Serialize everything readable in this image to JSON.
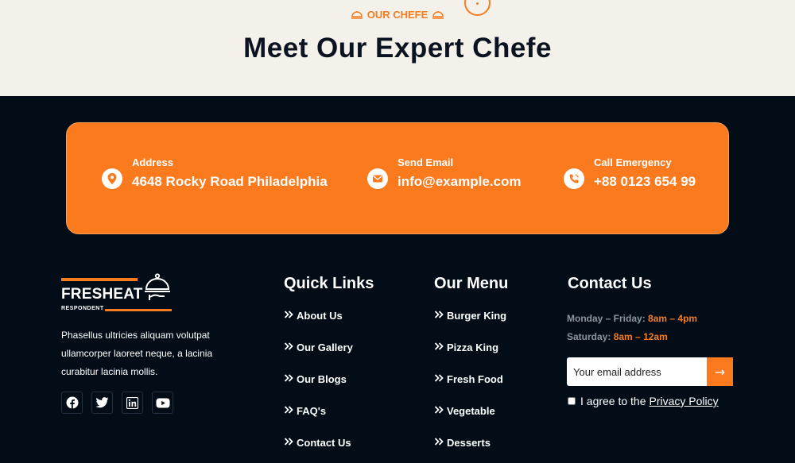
{
  "section": {
    "subtitle": "OUR CHEFE",
    "title": "Meet Our Expert Chefe"
  },
  "contact_bar": {
    "address": {
      "label": "Address",
      "value": "4648 Rocky Road Philadelphia"
    },
    "email": {
      "label": "Send Email",
      "value": "info@example.com"
    },
    "phone": {
      "label": "Call Emergency",
      "value": "+88 0123 654 99"
    }
  },
  "brand": {
    "name": "FRESHEAT",
    "tagline": "RESPONDENT",
    "description": "Phasellus ultricies aliquam volutpat ullamcorper laoreet neque, a lacinia curabitur lacinia mollis."
  },
  "social": [
    "facebook-icon",
    "twitter-icon",
    "linkedin-icon",
    "youtube-icon"
  ],
  "quick_links": {
    "heading": "Quick Links",
    "items": [
      "About Us",
      "Our Gallery",
      "Our Blogs",
      "FAQ's",
      "Contact Us"
    ]
  },
  "our_menu": {
    "heading": "Our Menu",
    "items": [
      "Burger King",
      "Pizza King",
      "Fresh Food",
      "Vegetable",
      "Desserts"
    ]
  },
  "contact_us": {
    "heading": "Contact Us",
    "weekday_label": "Monday – Friday:",
    "weekday_hours": "8am – 4pm",
    "saturday_label": "Saturday:",
    "saturday_hours": "8am – 12am",
    "email_placeholder": "Your email address",
    "submit_symbol": "→",
    "agree_text": "I agree to the",
    "privacy_link": "Privacy Policy"
  },
  "colors": {
    "accent": "#fb7a1d",
    "footer_bg": "#020d18",
    "top_bg": "#f4f1ea"
  }
}
